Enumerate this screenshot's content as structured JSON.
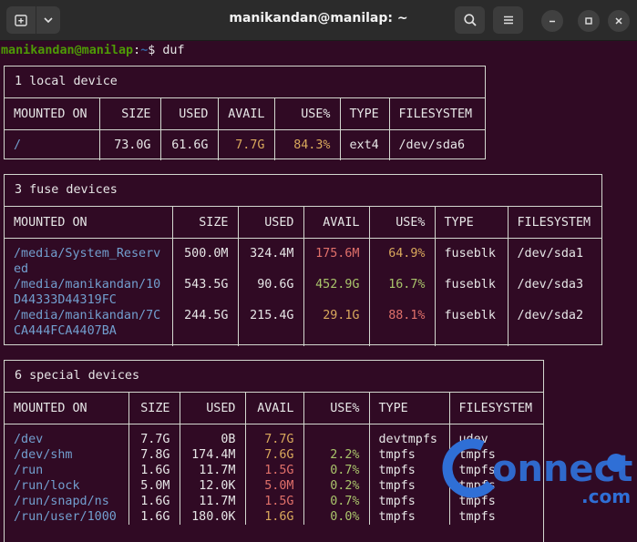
{
  "window": {
    "title": "manikandan@manilap: ~"
  },
  "prompt": {
    "user_host": "manikandan@manilap",
    "separator": ":",
    "path": "~",
    "symbol": "$",
    "command": "duf"
  },
  "local": {
    "title": "1 local device",
    "headers": [
      "MOUNTED ON",
      "SIZE",
      "USED",
      "AVAIL",
      "USE%",
      "TYPE",
      "FILESYSTEM"
    ],
    "rows": [
      {
        "mount": "/",
        "size": "73.0G",
        "used": "61.6G",
        "avail": "7.7G",
        "use": "84.3%",
        "type": "ext4",
        "fs": "/dev/sda6"
      }
    ]
  },
  "fuse": {
    "title": "3 fuse devices",
    "headers": [
      "MOUNTED ON",
      "SIZE",
      "USED",
      "AVAIL",
      "USE%",
      "TYPE",
      "FILESYSTEM"
    ],
    "rows": [
      {
        "mount": "/media/System_Reserved",
        "size": "500.0M",
        "used": "324.4M",
        "avail": "175.6M",
        "use": "64.9%",
        "type": "fuseblk",
        "fs": "/dev/sda1"
      },
      {
        "mount": "/media/manikandan/10D44333D44319FC",
        "size": "543.5G",
        "used": "90.6G",
        "avail": "452.9G",
        "use": "16.7%",
        "type": "fuseblk",
        "fs": "/dev/sda3"
      },
      {
        "mount": "/media/manikandan/7CCA444FCA4407BA",
        "size": "244.5G",
        "used": "215.4G",
        "avail": "29.1G",
        "use": "88.1%",
        "type": "fuseblk",
        "fs": "/dev/sda2"
      }
    ]
  },
  "special": {
    "title": "6 special devices",
    "headers": [
      "MOUNTED ON",
      "SIZE",
      "USED",
      "AVAIL",
      "USE%",
      "TYPE",
      "FILESYSTEM"
    ],
    "rows": [
      {
        "mount": "/dev",
        "size": "7.7G",
        "used": "0B",
        "avail": "7.7G",
        "use": "",
        "type": "devtmpfs",
        "fs": "udev"
      },
      {
        "mount": "/dev/shm",
        "size": "7.8G",
        "used": "174.4M",
        "avail": "7.6G",
        "use": "2.2%",
        "type": "tmpfs",
        "fs": "tmpfs"
      },
      {
        "mount": "/run",
        "size": "1.6G",
        "used": "11.7M",
        "avail": "1.5G",
        "use": "0.7%",
        "type": "tmpfs",
        "fs": "tmpfs"
      },
      {
        "mount": "/run/lock",
        "size": "5.0M",
        "used": "12.0K",
        "avail": "5.0M",
        "use": "0.2%",
        "type": "tmpfs",
        "fs": "tmpfs"
      },
      {
        "mount": "/run/snapd/ns",
        "size": "1.6G",
        "used": "11.7M",
        "avail": "1.5G",
        "use": "0.7%",
        "type": "tmpfs",
        "fs": "tmpfs"
      },
      {
        "mount": "/run/user/1000",
        "size": "1.6G",
        "used": "180.0K",
        "avail": "1.6G",
        "use": "0.0%",
        "type": "tmpfs",
        "fs": "tmpfs"
      }
    ]
  },
  "colors": {
    "background": "#300a24",
    "mount": "#729fcf",
    "warn": "#d9a85c",
    "critical": "#e0706a",
    "ok": "#a9c46b",
    "prompt_user": "#4e9a06",
    "prompt_path": "#3465a4"
  },
  "watermark": {
    "word": "onnect",
    "sub": ".com"
  }
}
